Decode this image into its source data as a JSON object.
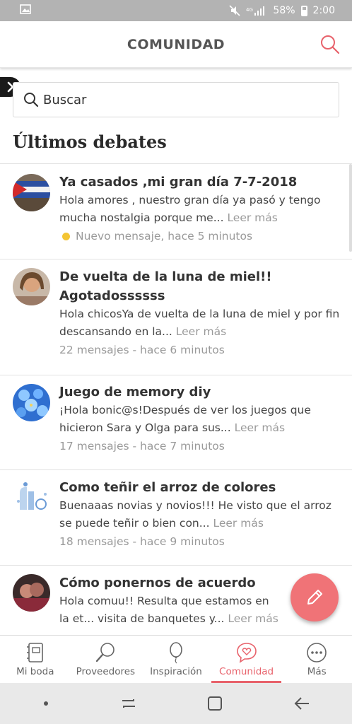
{
  "status_bar": {
    "battery": "58%",
    "time": "2:00"
  },
  "header": {
    "title": "COMUNIDAD"
  },
  "search": {
    "placeholder": "Buscar"
  },
  "section_title": "Últimos debates",
  "debates": [
    {
      "title": "Ya casados ,mi gran día 7-7-2018",
      "snippet": "Hola amores , nuestro gran día ya pasó y tengo mucha nostalgia porque me...",
      "read_more": "Leer más",
      "meta": "Nuevo mensaje, hace 5 minutos",
      "is_new": true
    },
    {
      "title": "De vuelta de la luna de miel!! Agotadossssss",
      "snippet": "Hola chicosYa de vuelta de la luna de miel y por fin descansando en la...",
      "read_more": "Leer más",
      "meta": "22 mensajes - hace 6 minutos",
      "is_new": false
    },
    {
      "title": "Juego de memory diy",
      "snippet": "¡Hola bonic@s!Después de ver los juegos que hicieron Sara y Olga para sus...",
      "read_more": "Leer más",
      "meta": "17 mensajes - hace 7 minutos",
      "is_new": false
    },
    {
      "title": "Como teñir el arroz de colores",
      "snippet": "Buenaaas novias y novios!!! He visto que el arroz se puede teñir o bien con...",
      "read_more": "Leer más",
      "meta": "18 mensajes - hace 9 minutos",
      "is_new": false
    },
    {
      "title": "Cómo ponernos de acuerdo",
      "snippet": "Hola comuu!! Resulta que estamos en la et... visita de banquetes y...",
      "read_more": "Leer más",
      "meta": "",
      "is_new": false
    }
  ],
  "bottom_nav": [
    {
      "label": "Mi boda",
      "icon": "notebook-icon"
    },
    {
      "label": "Proveedores",
      "icon": "search-icon"
    },
    {
      "label": "Inspiración",
      "icon": "balloon-icon"
    },
    {
      "label": "Comunidad",
      "icon": "chat-heart-icon",
      "active": true
    },
    {
      "label": "Más",
      "icon": "more-icon"
    }
  ],
  "colors": {
    "accent": "#e8626b",
    "fab": "#f07377",
    "new_dot": "#f4c534"
  }
}
